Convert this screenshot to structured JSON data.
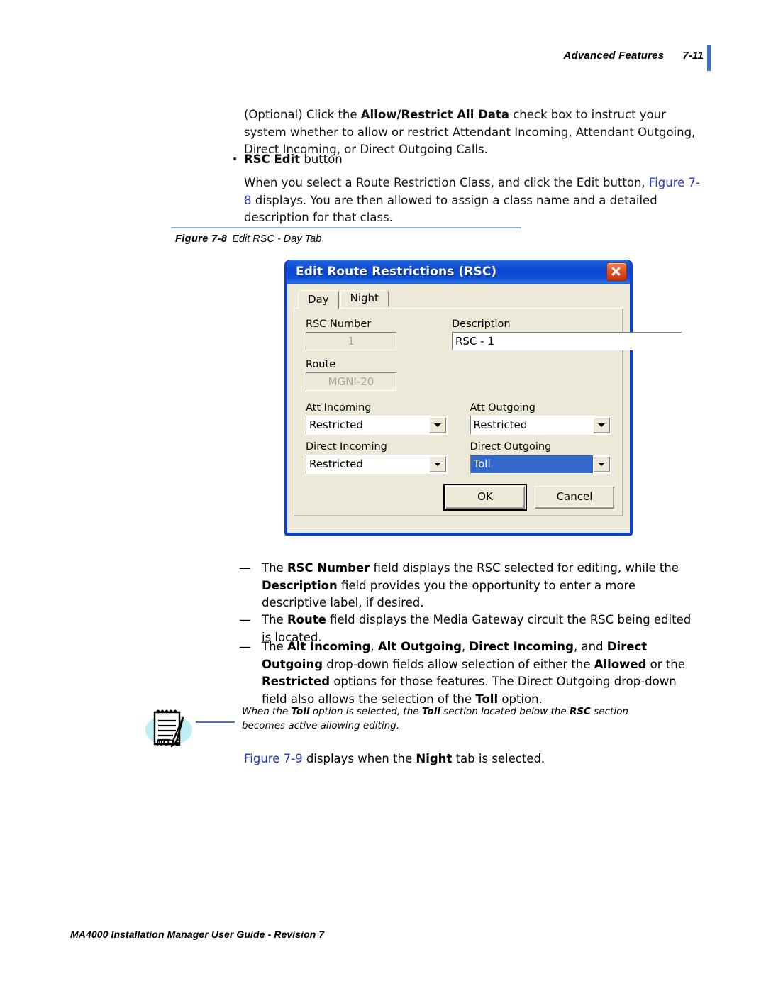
{
  "header": {
    "chapter_title": "Advanced Features",
    "page_number": "7-11"
  },
  "content": {
    "optional_paragraph": {
      "pre": "(Optional) Click the ",
      "bold1": "Allow/Restrict All Data",
      "post": " check box to instruct your system whether to allow or restrict Attendant Incoming, Attendant Outgoing, Direct Incoming, or Direct Outgoing Calls."
    },
    "bullet": {
      "marker": "•",
      "bold": "RSC Edit",
      "rest": " button"
    },
    "edit_paragraph": {
      "pre": "When you select a Route Restriction Class, and click the Edit button, ",
      "link": "Figure 7-8",
      "post": " displays. You are then allowed to assign a class name and a detailed description for that class."
    }
  },
  "figure": {
    "number": "Figure 7-8",
    "title": "Edit RSC - Day Tab"
  },
  "dialog": {
    "title": "Edit Route Restrictions (RSC)",
    "close_label": "Close",
    "tabs": [
      {
        "label": "Day",
        "active": true
      },
      {
        "label": "Night",
        "active": false
      }
    ],
    "fields": {
      "rsc_number_label": "RSC Number",
      "rsc_number_value": "1",
      "description_label": "Description",
      "description_value": "RSC - 1",
      "route_label": "Route",
      "route_value": "MGNI-20"
    },
    "dropdowns": [
      {
        "label": "Att Incoming",
        "value": "Restricted",
        "selected": false
      },
      {
        "label": "Att Outgoing",
        "value": "Restricted",
        "selected": false
      },
      {
        "label": "Direct Incoming",
        "value": "Restricted",
        "selected": false
      },
      {
        "label": "Direct Outgoing",
        "value": "Toll",
        "selected": true
      }
    ],
    "buttons": {
      "ok": "OK",
      "cancel": "Cancel"
    },
    "colors": {
      "titlebar_blue": "#0d48cf",
      "face": "#ece9d8",
      "selection_blue": "#3267cc",
      "close_red": "#c8340c"
    }
  },
  "dash_items": [
    {
      "dash": "—",
      "parts": [
        {
          "t": "The ",
          "b": false
        },
        {
          "t": "RSC Number",
          "b": true
        },
        {
          "t": " field displays the RSC selected for editing, while the ",
          "b": false
        },
        {
          "t": "Description",
          "b": true
        },
        {
          "t": " field provides you the opportunity to enter a more descriptive label, if desired.",
          "b": false
        }
      ]
    },
    {
      "dash": "—",
      "parts": [
        {
          "t": "The ",
          "b": false
        },
        {
          "t": "Route",
          "b": true
        },
        {
          "t": " field displays the Media Gateway circuit the RSC being edited is located.",
          "b": false
        }
      ]
    },
    {
      "dash": "—",
      "parts": [
        {
          "t": "The ",
          "b": false
        },
        {
          "t": "Alt Incoming",
          "b": true
        },
        {
          "t": ", ",
          "b": false
        },
        {
          "t": "Alt Outgoing",
          "b": true
        },
        {
          "t": ", ",
          "b": false
        },
        {
          "t": "Direct Incoming",
          "b": true
        },
        {
          "t": ", and ",
          "b": false
        },
        {
          "t": "Direct Outgoing",
          "b": true
        },
        {
          "t": " drop-down fields allow selection of either the ",
          "b": false
        },
        {
          "t": "Allowed",
          "b": true
        },
        {
          "t": " or the ",
          "b": false
        },
        {
          "t": "Restricted",
          "b": true
        },
        {
          "t": " options for those features. The Direct Outgoing drop-down field also allows the selection of the ",
          "b": false
        },
        {
          "t": "Toll",
          "b": true
        },
        {
          "t": " option.",
          "b": false
        }
      ]
    }
  ],
  "note": {
    "label": "NOTE",
    "icon": "notepad-pen-icon",
    "parts": [
      {
        "t": "When the ",
        "b": false
      },
      {
        "t": "Toll",
        "b": true
      },
      {
        "t": " option is selected, the ",
        "b": false
      },
      {
        "t": "Toll",
        "b": true
      },
      {
        "t": " section located below the ",
        "b": false
      },
      {
        "t": "RSC",
        "b": true
      },
      {
        "t": " section becomes active allowing editing.",
        "b": false
      }
    ]
  },
  "figure9_line": {
    "link": "Figure 7-9",
    "mid": " displays when the ",
    "bold": "Night",
    "post": " tab is selected."
  },
  "footer": {
    "text": "MA4000 Installation Manager User Guide - Revision 7"
  }
}
